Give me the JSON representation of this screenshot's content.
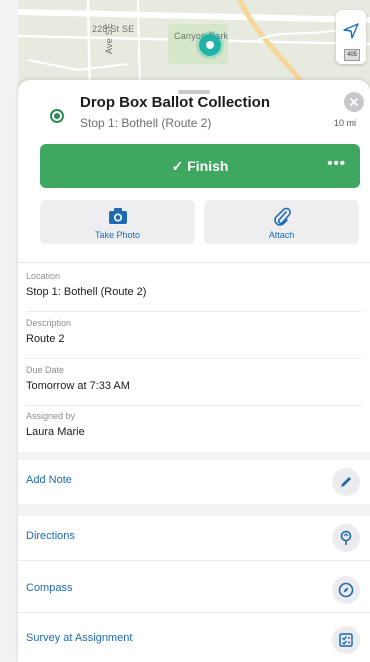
{
  "map": {
    "street_label": "228 St SE",
    "park_label": "Canyon Park",
    "avenue_label": "Ave SE",
    "nav_badge": "405"
  },
  "task": {
    "title": "Drop Box Ballot Collection",
    "subtitle": "Stop 1: Bothell (Route 2)",
    "distance": "10 mi"
  },
  "actions": {
    "finish_label": "✓ Finish",
    "more_label": "•••",
    "take_photo_label": "Take Photo",
    "attach_label": "Attach"
  },
  "details": [
    {
      "label": "Location",
      "value": "Stop 1: Bothell (Route 2)"
    },
    {
      "label": "Description",
      "value": "Route 2"
    },
    {
      "label": "Due Date",
      "value": "Tomorrow at 7:33 AM"
    },
    {
      "label": "Assigned by",
      "value": "Laura Marie"
    }
  ],
  "rows": {
    "add_note": "Add Note",
    "directions": "Directions",
    "compass": "Compass",
    "survey": "Survey at Assignment"
  },
  "colors": {
    "accent": "#1e6bb0",
    "finish_green": "#3ea760",
    "status_green": "#2e8b57",
    "pin_teal": "#21b3a8"
  }
}
